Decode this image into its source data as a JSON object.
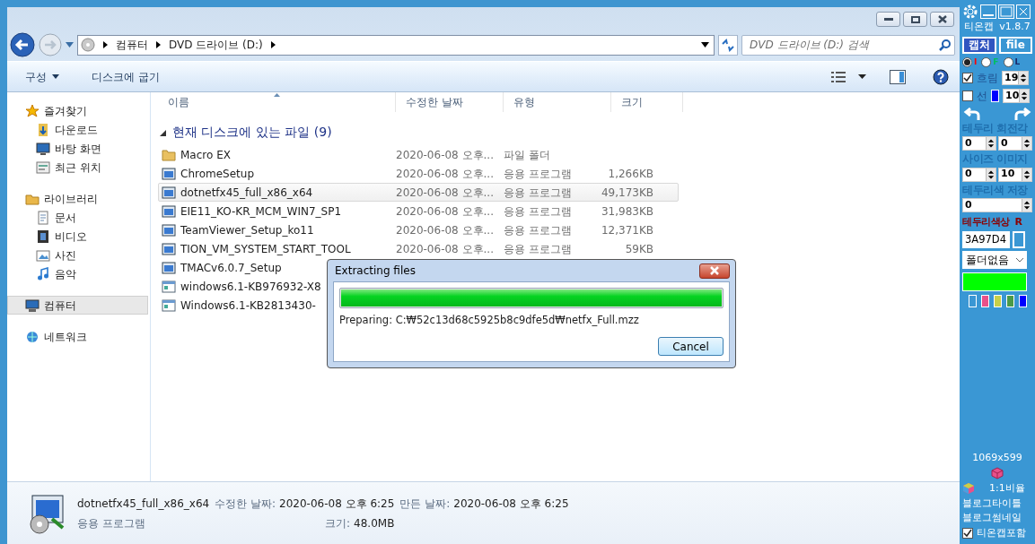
{
  "address": {
    "crumbs": [
      "컴퓨터",
      "DVD 드라이브 (D:)"
    ]
  },
  "search": {
    "placeholder": "DVD 드라이브 (D:) 검색"
  },
  "toolbar": {
    "buttons": [
      "구성",
      "디스크에 굽기"
    ]
  },
  "sidebar": {
    "items": [
      {
        "label": "즐겨찾기",
        "kind": "star",
        "selected": false,
        "children": [
          {
            "label": "다운로드",
            "kind": "download",
            "selected": false
          },
          {
            "label": "바탕 화면",
            "kind": "desktop",
            "selected": false
          },
          {
            "label": "최근 위치",
            "kind": "recent",
            "selected": false
          }
        ]
      },
      {
        "label": "라이브러리",
        "kind": "library",
        "selected": false,
        "children": [
          {
            "label": "문서",
            "kind": "document",
            "selected": false
          },
          {
            "label": "비디오",
            "kind": "video",
            "selected": false
          },
          {
            "label": "사진",
            "kind": "picture",
            "selected": false
          },
          {
            "label": "음악",
            "kind": "music",
            "selected": false
          }
        ]
      },
      {
        "label": "컴퓨터",
        "kind": "computer",
        "selected": true
      },
      {
        "label": "네트워크",
        "kind": "network",
        "selected": false
      }
    ]
  },
  "table": {
    "columns": [
      "이름",
      "수정한 날짜",
      "유형",
      "크기"
    ],
    "group": {
      "label": "현재 디스크에 있는 파일 (9)",
      "expanded": true
    },
    "rows": [
      {
        "name": "Macro EX",
        "date": "2020-06-08 오후...",
        "type": "파일 폴더",
        "kind": "folder",
        "selected": false
      },
      {
        "name": "ChromeSetup",
        "date": "2020-06-08 오후...",
        "type": "응용 프로그램",
        "size": "1,266KB",
        "kind": "app",
        "selected": false
      },
      {
        "name": "dotnetfx45_full_x86_x64",
        "date": "2020-06-08 오후...",
        "type": "응용 프로그램",
        "size": "49,173KB",
        "kind": "app",
        "selected": true
      },
      {
        "name": "EIE11_KO-KR_MCM_WIN7_SP1",
        "date": "2020-06-08 오후...",
        "type": "응용 프로그램",
        "size": "31,983KB",
        "kind": "app",
        "selected": false
      },
      {
        "name": "TeamViewer_Setup_ko11",
        "date": "2020-06-08 오후...",
        "type": "응용 프로그램",
        "size": "12,371KB",
        "kind": "app",
        "selected": false
      },
      {
        "name": "TION_VM_SYSTEM_START_TOOL",
        "date": "2020-06-08 오후...",
        "type": "응용 프로그램",
        "size": "59KB",
        "kind": "app",
        "selected": false
      },
      {
        "name": "TMACv6.0.7_Setup",
        "kind": "app",
        "selected": false
      },
      {
        "name": "windows6.1-KB976932-X8",
        "kind": "update",
        "selected": false
      },
      {
        "name": "Windows6.1-KB2813430-",
        "kind": "update",
        "selected": false
      }
    ]
  },
  "details": {
    "name": "dotnetfx45_full_x86_x64",
    "type": "응용 프로그램",
    "fields": [
      {
        "label": "수정한 날짜:",
        "value": "2020-06-08 오후 6:25"
      },
      {
        "label": "만든 날짜:",
        "value": "2020-06-08 오후 6:25"
      },
      {
        "label": "크기:",
        "value": "48.0MB"
      }
    ]
  },
  "dialog": {
    "title": "Extracting files",
    "level": 1,
    "status": "Preparing: C:₩52c13d68c5925b8c9dfe5d₩netfx_Full.mzz",
    "button": "Cancel"
  },
  "capture_tool": {
    "title": "티온캡",
    "version": "v1.8.7",
    "buttons": [
      "캡처",
      "file"
    ],
    "radios": [
      {
        "label": "I",
        "selected": true,
        "color": "#ff0000"
      },
      {
        "label": "F",
        "selected": false,
        "color": "#00c060"
      },
      {
        "label": "L",
        "selected": false,
        "color": "#1a2a6a"
      }
    ],
    "blur": {
      "label": "흐림",
      "checked": true,
      "value": "19"
    },
    "line": {
      "label": "선",
      "checked": false,
      "value": "10",
      "color": "#0000ff"
    },
    "rotation": {
      "label": "테두리 회전각",
      "values": [
        "0",
        "0"
      ]
    },
    "size": {
      "label": "사이즈 이미지",
      "values": [
        "0",
        "10"
      ]
    },
    "border_save": {
      "label": "테두리색 저장",
      "value": "0"
    },
    "border_color": {
      "label": "테두리색상",
      "channel": "R",
      "hex": "3A97D4",
      "color": "#3a97d4"
    },
    "folder": "폴더없음",
    "preview": {
      "color": "#00ff00"
    },
    "palette": [
      {
        "color": "#3a97d4"
      },
      {
        "color": "#e8508a"
      },
      {
        "color": "#c8d048"
      },
      {
        "color": "#4a9a48"
      },
      {
        "color": "#0000ff"
      }
    ],
    "dimensions": "1069x599",
    "ratio": "1:1비율",
    "links": [
      "블로그타이틀",
      "블로그썸네일"
    ],
    "include": {
      "label": "티온캡포함",
      "checked": true
    }
  }
}
